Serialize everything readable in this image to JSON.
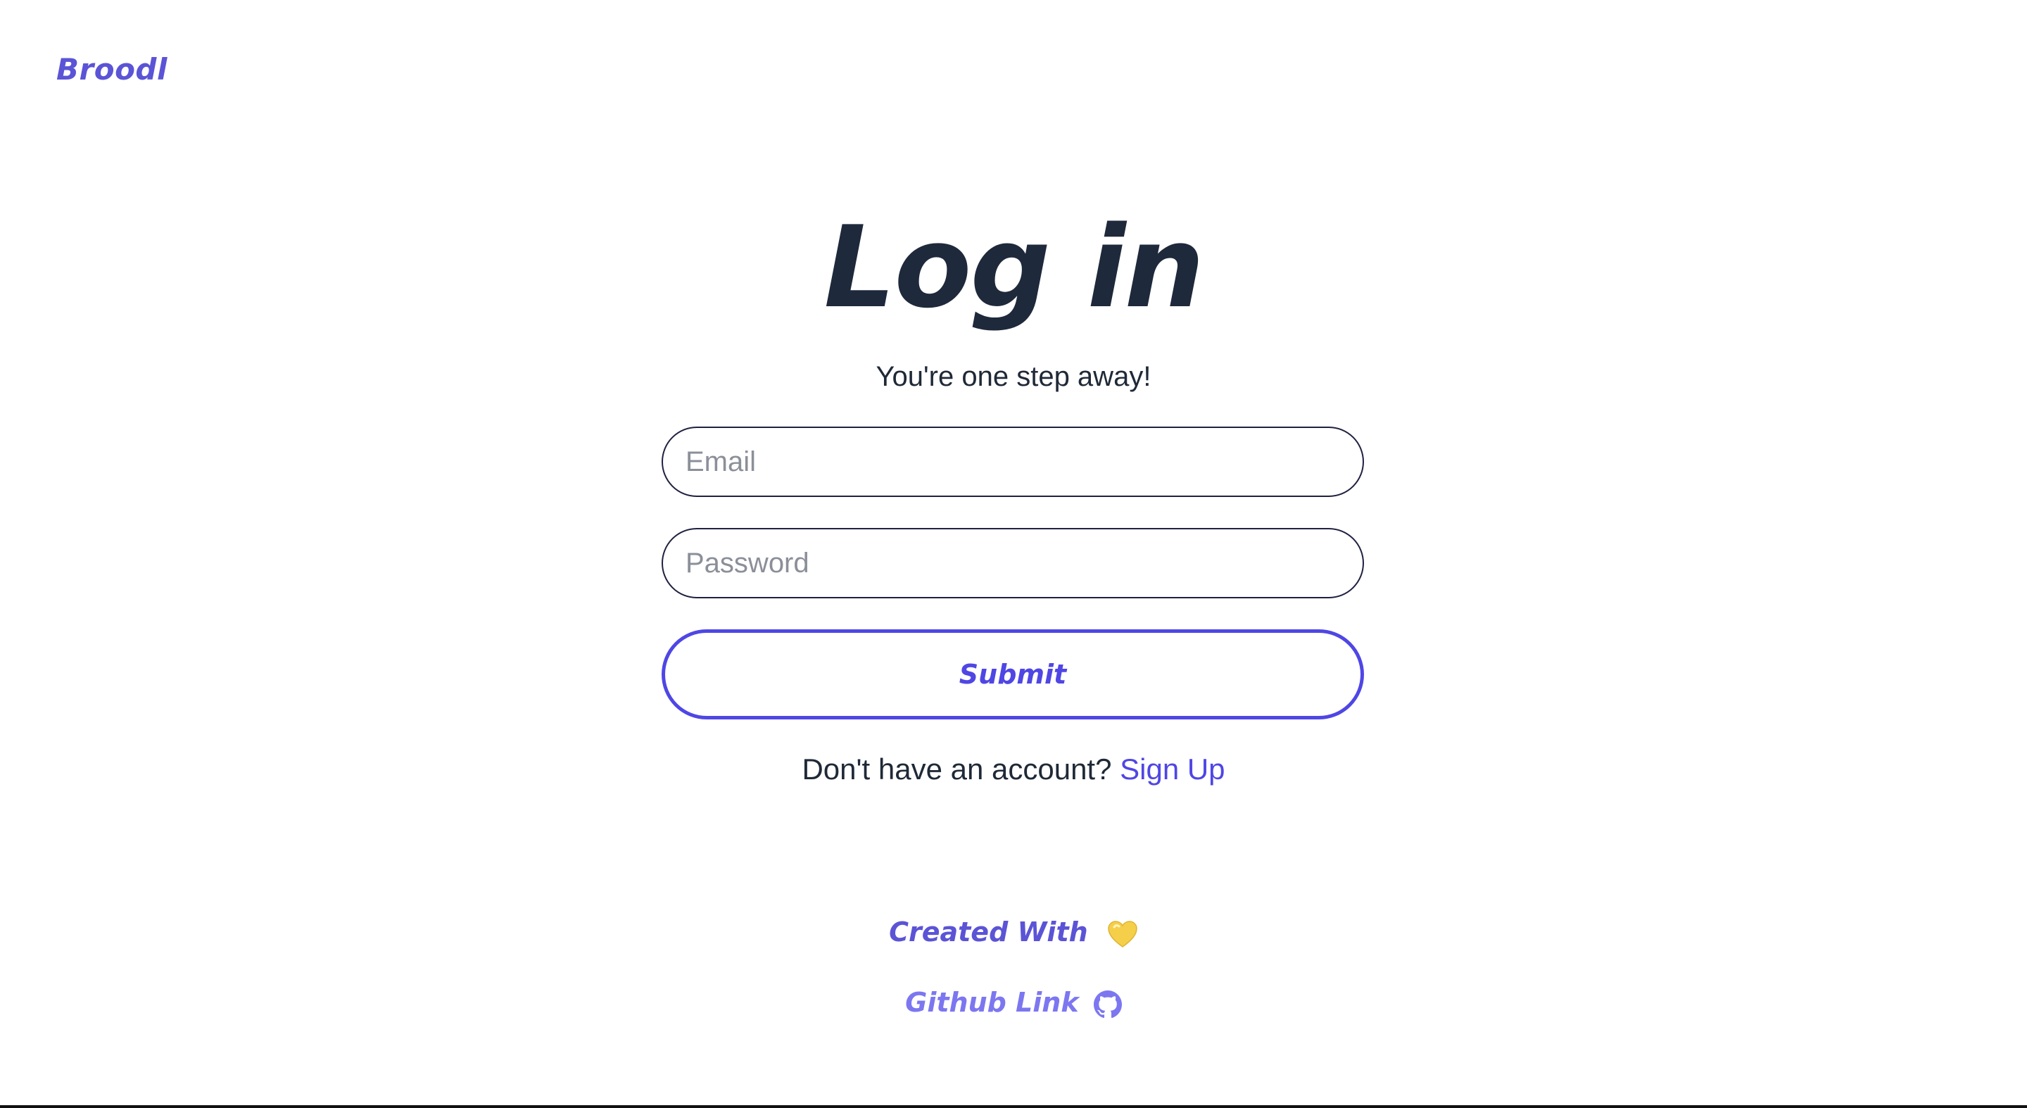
{
  "header": {
    "brand": "Broodl"
  },
  "login": {
    "title": "Log in",
    "subtitle": "You're one step away!",
    "email_placeholder": "Email",
    "password_placeholder": "Password",
    "submit_label": "Submit",
    "signup_prompt": "Don't have an account?",
    "signup_link": "Sign Up"
  },
  "footer": {
    "credit_label": "Created With",
    "heart_icon": "yellow-heart-icon",
    "github_label": "Github Link",
    "github_icon": "github-icon"
  },
  "colors": {
    "accent": "#4f46e5",
    "brand": "#5b54d6",
    "heading": "#1e293b",
    "github_link": "#7c77f0",
    "heart": "#f5cf4a"
  }
}
